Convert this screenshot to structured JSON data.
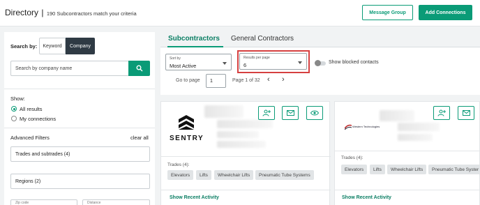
{
  "header": {
    "title": "Directory",
    "separator": "|",
    "match_text": "190 Subcontractors match your criteria",
    "message_group_label": "Message Group",
    "add_connections_label": "Add Connections"
  },
  "sidebar": {
    "search_by_label": "Search by:",
    "keyword_label": "Keyword",
    "company_label": "Company",
    "search_placeholder": "Search by company name",
    "show_label": "Show:",
    "radio_all": "All results",
    "radio_connections": "My connections",
    "advanced_filters_label": "Advanced Filters",
    "clear_all_label": "clear all",
    "trades_filter": "Trades and subtrades (4)",
    "regions_filter": "Regions (2)",
    "zip_label": "Zip code",
    "distance_label": "Distance"
  },
  "tabs": [
    {
      "label": "Subcontractors",
      "active": true
    },
    {
      "label": "General Contractors",
      "active": false
    }
  ],
  "controls": {
    "sort_label": "Sort by",
    "sort_value": "Most Active",
    "results_label": "Results per page",
    "results_value": "6",
    "blocked_label": "Show blocked contacts",
    "goto_label": "Go to page",
    "page_input_value": "1",
    "page_info": "Page 1 of 32",
    "prev_glyph": "‹",
    "next_glyph": "›"
  },
  "cards": [
    {
      "logo_text": "SENTRY",
      "trades_label": "Trades (4):",
      "trades": [
        "Elevators",
        "Lifts",
        "Wheelchair Lifts",
        "Pneumatic Tube Systems"
      ],
      "recent_label": "Show Recent Activity"
    },
    {
      "logo_text": "Western Technologies",
      "trades_label": "Trades (4):",
      "trades": [
        "Elevators",
        "Lifts",
        "Wheelchair Lifts",
        "Pneumatic Tube Syster"
      ],
      "recent_label": "Show Recent Activity"
    }
  ],
  "colors": {
    "accent": "#0a9b77",
    "highlight": "#d64040",
    "background": "#f1f3f4"
  }
}
